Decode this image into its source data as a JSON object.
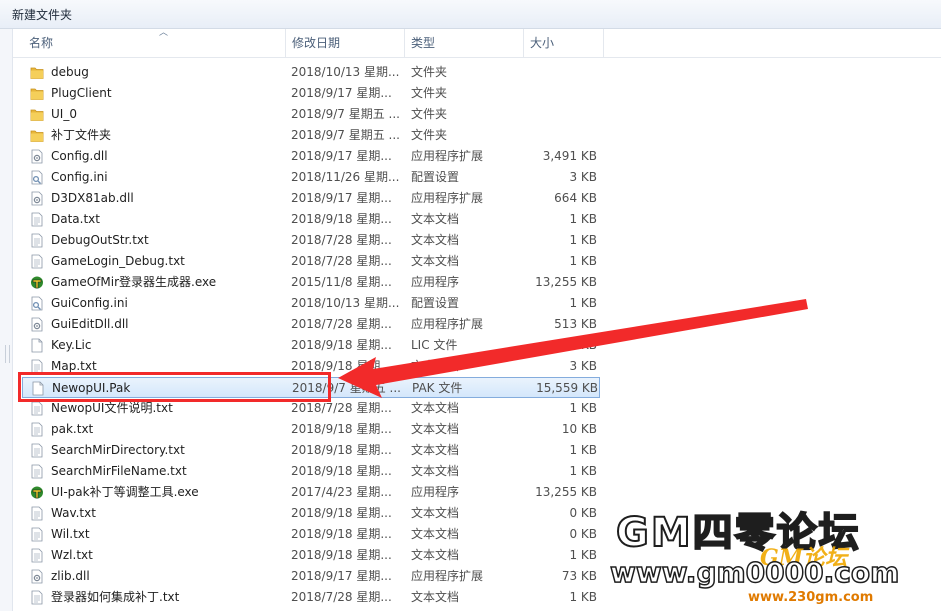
{
  "window": {
    "title": "新建文件夹"
  },
  "columns": {
    "name": "名称",
    "date": "修改日期",
    "type": "类型",
    "size": "大小"
  },
  "files": [
    {
      "name": "debug",
      "date": "2018/10/13 星期...",
      "type": "文件夹",
      "size": "",
      "icon": "folder-icon"
    },
    {
      "name": "PlugClient",
      "date": "2018/9/17 星期...",
      "type": "文件夹",
      "size": "",
      "icon": "folder-icon"
    },
    {
      "name": "UI_0",
      "date": "2018/9/7 星期五 ...",
      "type": "文件夹",
      "size": "",
      "icon": "folder-icon"
    },
    {
      "name": "补丁文件夹",
      "date": "2018/9/7 星期五 ...",
      "type": "文件夹",
      "size": "",
      "icon": "folder-icon"
    },
    {
      "name": "Config.dll",
      "date": "2018/9/17 星期...",
      "type": "应用程序扩展",
      "size": "3,491 KB",
      "icon": "dll-icon"
    },
    {
      "name": "Config.ini",
      "date": "2018/11/26 星期...",
      "type": "配置设置",
      "size": "3 KB",
      "icon": "ini-icon"
    },
    {
      "name": "D3DX81ab.dll",
      "date": "2018/9/17 星期...",
      "type": "应用程序扩展",
      "size": "664 KB",
      "icon": "dll-icon"
    },
    {
      "name": "Data.txt",
      "date": "2018/9/18 星期...",
      "type": "文本文档",
      "size": "1 KB",
      "icon": "text-file-icon"
    },
    {
      "name": "DebugOutStr.txt",
      "date": "2018/7/28 星期...",
      "type": "文本文档",
      "size": "1 KB",
      "icon": "text-file-icon"
    },
    {
      "name": "GameLogin_Debug.txt",
      "date": "2018/7/28 星期...",
      "type": "文本文档",
      "size": "1 KB",
      "icon": "text-file-icon"
    },
    {
      "name": "GameOfMir登录器生成器.exe",
      "date": "2015/11/8 星期...",
      "type": "应用程序",
      "size": "13,255 KB",
      "icon": "exe-icon"
    },
    {
      "name": "GuiConfig.ini",
      "date": "2018/10/13 星期...",
      "type": "配置设置",
      "size": "1 KB",
      "icon": "ini-icon"
    },
    {
      "name": "GuiEditDll.dll",
      "date": "2018/7/28 星期...",
      "type": "应用程序扩展",
      "size": "513 KB",
      "icon": "dll-icon"
    },
    {
      "name": "Key.Lic",
      "date": "2018/9/18 星期...",
      "type": "LIC 文件",
      "size": "10 KB",
      "icon": "blank-file-icon"
    },
    {
      "name": "Map.txt",
      "date": "2018/9/18 星期...",
      "type": "文本文档",
      "size": "3 KB",
      "icon": "text-file-icon"
    },
    {
      "name": "NewopUI.Pak",
      "date": "2018/9/7 星期五 ...",
      "type": "PAK 文件",
      "size": "15,559 KB",
      "icon": "blank-file-icon",
      "selected": true
    },
    {
      "name": "NewopUI文件说明.txt",
      "date": "2018/7/28 星期...",
      "type": "文本文档",
      "size": "1 KB",
      "icon": "text-file-icon"
    },
    {
      "name": "pak.txt",
      "date": "2018/9/18 星期...",
      "type": "文本文档",
      "size": "10 KB",
      "icon": "text-file-icon"
    },
    {
      "name": "SearchMirDirectory.txt",
      "date": "2018/9/18 星期...",
      "type": "文本文档",
      "size": "1 KB",
      "icon": "text-file-icon"
    },
    {
      "name": "SearchMirFileName.txt",
      "date": "2018/9/18 星期...",
      "type": "文本文档",
      "size": "1 KB",
      "icon": "text-file-icon"
    },
    {
      "name": "UI-pak补丁等调整工具.exe",
      "date": "2017/4/23 星期...",
      "type": "应用程序",
      "size": "13,255 KB",
      "icon": "exe-icon"
    },
    {
      "name": "Wav.txt",
      "date": "2018/9/18 星期...",
      "type": "文本文档",
      "size": "0 KB",
      "icon": "text-file-icon"
    },
    {
      "name": "Wil.txt",
      "date": "2018/9/18 星期...",
      "type": "文本文档",
      "size": "0 KB",
      "icon": "text-file-icon"
    },
    {
      "name": "Wzl.txt",
      "date": "2018/9/18 星期...",
      "type": "文本文档",
      "size": "1 KB",
      "icon": "text-file-icon"
    },
    {
      "name": "zlib.dll",
      "date": "2018/9/17 星期...",
      "type": "应用程序扩展",
      "size": "73 KB",
      "icon": "dll-icon"
    },
    {
      "name": "登录器如何集成补丁.txt",
      "date": "2018/7/28 星期...",
      "type": "文本文档",
      "size": "1 KB",
      "icon": "text-file-icon"
    }
  ],
  "watermark": {
    "title": "GM四零论坛",
    "url": "www.gm0000.com",
    "logo": "GM论坛",
    "site": "www.230gm.com"
  },
  "colors": {
    "annotation": "#f22a2a",
    "selection": "#d4e7fb",
    "folder": "#e8b73c"
  }
}
